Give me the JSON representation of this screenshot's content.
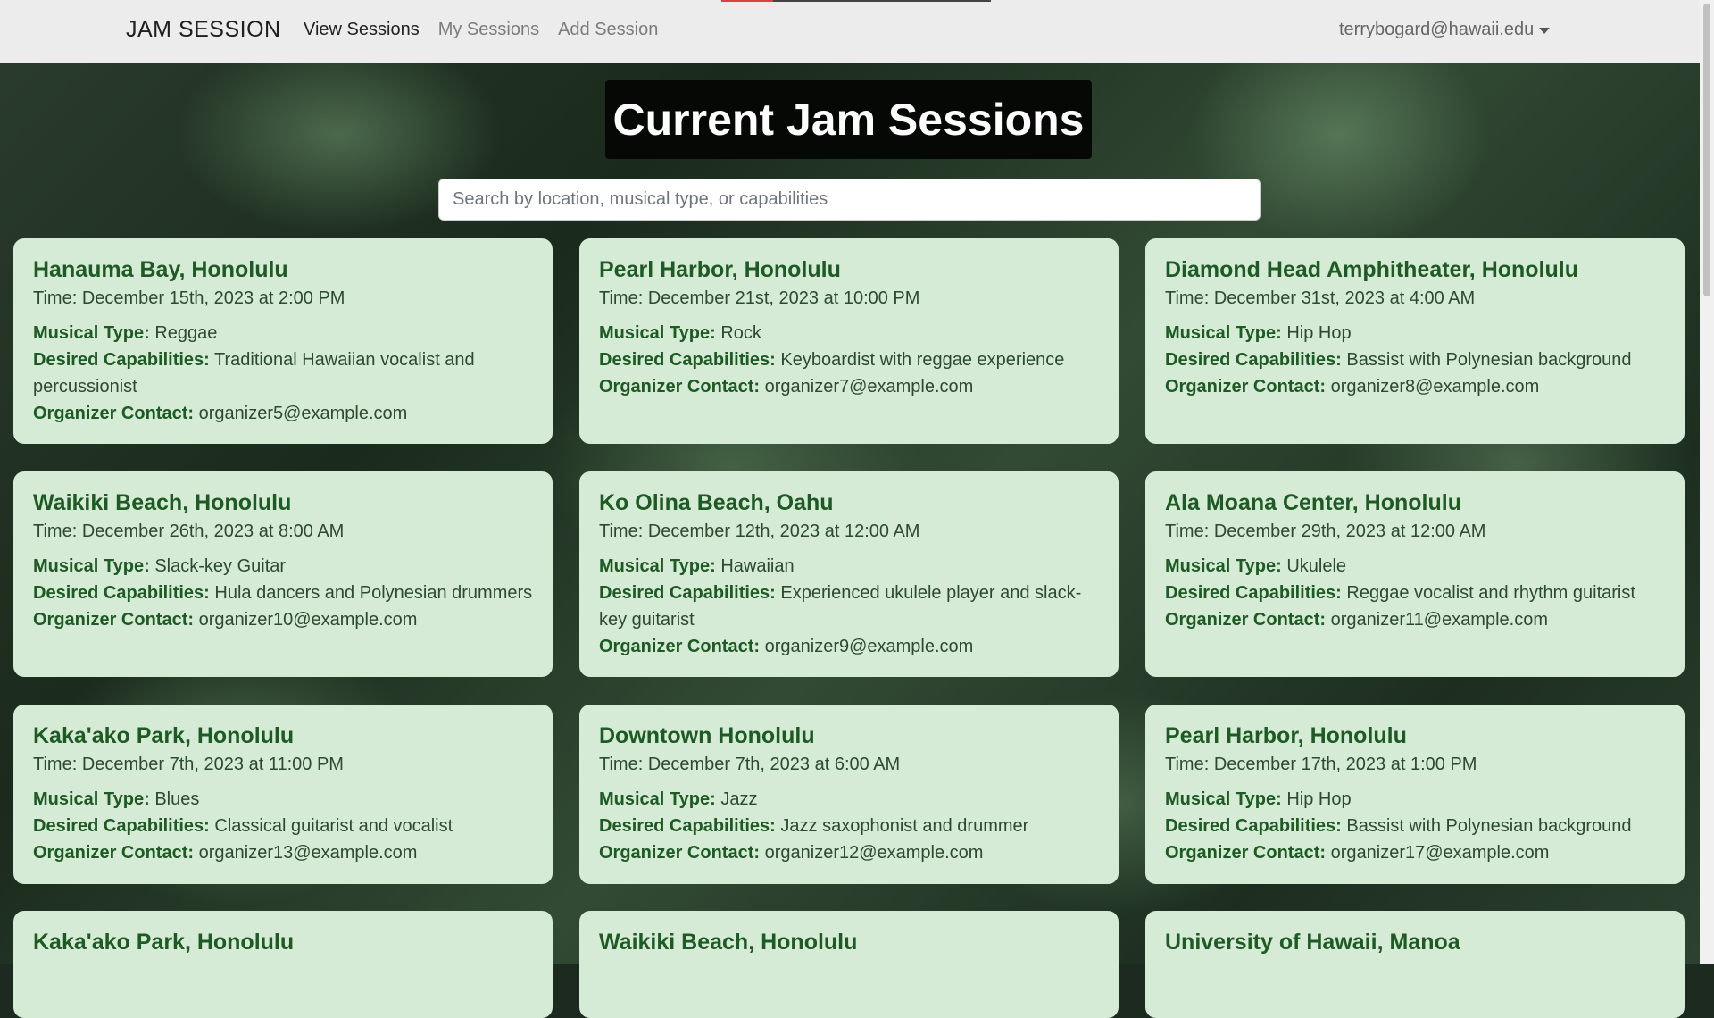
{
  "nav": {
    "brand": "JAM SESSION",
    "links": [
      "View Sessions",
      "My Sessions",
      "Add Session"
    ],
    "user": "terrybogard@hawaii.edu"
  },
  "page": {
    "title": "Current Jam Sessions",
    "search_placeholder": "Search by location, musical type, or capabilities"
  },
  "labels": {
    "musical_type": "Musical Type:",
    "capabilities": "Desired Capabilities:",
    "contact": "Organizer Contact:"
  },
  "sessions": [
    {
      "location": "Hanauma Bay, Honolulu",
      "time": "Time: December 15th, 2023 at 2:00 PM",
      "type": "Reggae",
      "capabilities": "Traditional Hawaiian vocalist and percussionist",
      "contact": "organizer5@example.com"
    },
    {
      "location": "Pearl Harbor, Honolulu",
      "time": "Time: December 21st, 2023 at 10:00 PM",
      "type": "Rock",
      "capabilities": "Keyboardist with reggae experience",
      "contact": "organizer7@example.com"
    },
    {
      "location": "Diamond Head Amphitheater, Honolulu",
      "time": "Time: December 31st, 2023 at 4:00 AM",
      "type": "Hip Hop",
      "capabilities": "Bassist with Polynesian background",
      "contact": "organizer8@example.com"
    },
    {
      "location": "Waikiki Beach, Honolulu",
      "time": "Time: December 26th, 2023 at 8:00 AM",
      "type": "Slack-key Guitar",
      "capabilities": "Hula dancers and Polynesian drummers",
      "contact": "organizer10@example.com"
    },
    {
      "location": "Ko Olina Beach, Oahu",
      "time": "Time: December 12th, 2023 at 12:00 AM",
      "type": "Hawaiian",
      "capabilities": "Experienced ukulele player and slack-key guitarist",
      "contact": "organizer9@example.com"
    },
    {
      "location": "Ala Moana Center, Honolulu",
      "time": "Time: December 29th, 2023 at 12:00 AM",
      "type": "Ukulele",
      "capabilities": "Reggae vocalist and rhythm guitarist",
      "contact": "organizer11@example.com"
    },
    {
      "location": "Kaka'ako Park, Honolulu",
      "time": "Time: December 7th, 2023 at 11:00 PM",
      "type": "Blues",
      "capabilities": "Classical guitarist and vocalist",
      "contact": "organizer13@example.com"
    },
    {
      "location": "Downtown Honolulu",
      "time": "Time: December 7th, 2023 at 6:00 AM",
      "type": "Jazz",
      "capabilities": "Jazz saxophonist and drummer",
      "contact": "organizer12@example.com"
    },
    {
      "location": "Pearl Harbor, Honolulu",
      "time": "Time: December 17th, 2023 at 1:00 PM",
      "type": "Hip Hop",
      "capabilities": "Bassist with Polynesian background",
      "contact": "organizer17@example.com"
    },
    {
      "location": "Kaka'ako Park, Honolulu"
    },
    {
      "location": "Waikiki Beach, Honolulu"
    },
    {
      "location": "University of Hawaii, Manoa"
    }
  ]
}
